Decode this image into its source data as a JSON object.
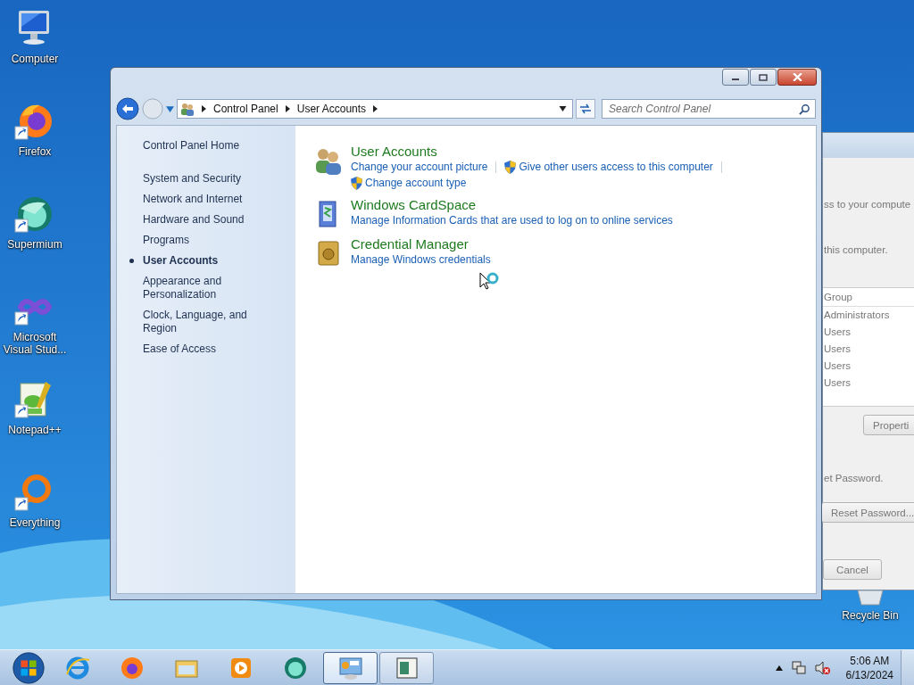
{
  "desktop_icons": [
    {
      "label": "Computer",
      "kind": "computer",
      "shortcut": false
    },
    {
      "label": "Firefox",
      "kind": "firefox",
      "shortcut": true
    },
    {
      "label": "Supermium",
      "kind": "supermium",
      "shortcut": true
    },
    {
      "label": "Microsoft Visual Stud...",
      "kind": "visualstudio",
      "shortcut": true
    },
    {
      "label": "Notepad++",
      "kind": "notepad",
      "shortcut": true
    },
    {
      "label": "Everything",
      "kind": "everything",
      "shortcut": true
    }
  ],
  "background_dialog": {
    "text_1": "ss to your compute",
    "text_2": "this computer.",
    "column": "Group",
    "rows": [
      "Administrators",
      "Users",
      "Users",
      "Users",
      "Users"
    ],
    "properties_button": "Properti",
    "text_3": "et Password.",
    "reset_button": "Reset Password...",
    "cancel_button": "Cancel"
  },
  "window": {
    "breadcrumb": [
      "Control Panel",
      "User Accounts"
    ],
    "search": {
      "placeholder": "Search Control Panel"
    },
    "sidebar": {
      "home": "Control Panel Home",
      "items": [
        {
          "label": "System and Security",
          "selected": false
        },
        {
          "label": "Network and Internet",
          "selected": false
        },
        {
          "label": "Hardware and Sound",
          "selected": false
        },
        {
          "label": "Programs",
          "selected": false
        },
        {
          "label": "User Accounts",
          "selected": true
        },
        {
          "label": "Appearance and Personalization",
          "selected": false
        },
        {
          "label": "Clock, Language, and Region",
          "selected": false
        },
        {
          "label": "Ease of Access",
          "selected": false
        }
      ]
    },
    "categories": [
      {
        "title": "User Accounts",
        "kind": "users",
        "links": [
          {
            "text": "Change your account picture",
            "shield": false
          },
          {
            "text": "Give other users access to this computer",
            "shield": true
          },
          {
            "text": "Change account type",
            "shield": true
          }
        ]
      },
      {
        "title": "Windows CardSpace",
        "kind": "cardspace",
        "links": [
          {
            "text": "Manage Information Cards that are used to log on to online services",
            "shield": false
          }
        ]
      },
      {
        "title": "Credential Manager",
        "kind": "vault",
        "links": [
          {
            "text": "Manage Windows credentials",
            "shield": false
          }
        ]
      }
    ]
  },
  "recycle_bin": {
    "label": "Recycle Bin"
  },
  "taskbar": {
    "items": [
      {
        "kind": "ie",
        "open": false,
        "selected": false
      },
      {
        "kind": "firefox",
        "open": false,
        "selected": false
      },
      {
        "kind": "explorer",
        "open": false,
        "selected": false
      },
      {
        "kind": "media",
        "open": false,
        "selected": false
      },
      {
        "kind": "supermium",
        "open": false,
        "selected": false
      },
      {
        "kind": "controlpanel",
        "open": true,
        "selected": true
      },
      {
        "kind": "document",
        "open": true,
        "selected": false
      }
    ],
    "clock": {
      "time": "5:06 AM",
      "date": "6/13/2024"
    }
  }
}
